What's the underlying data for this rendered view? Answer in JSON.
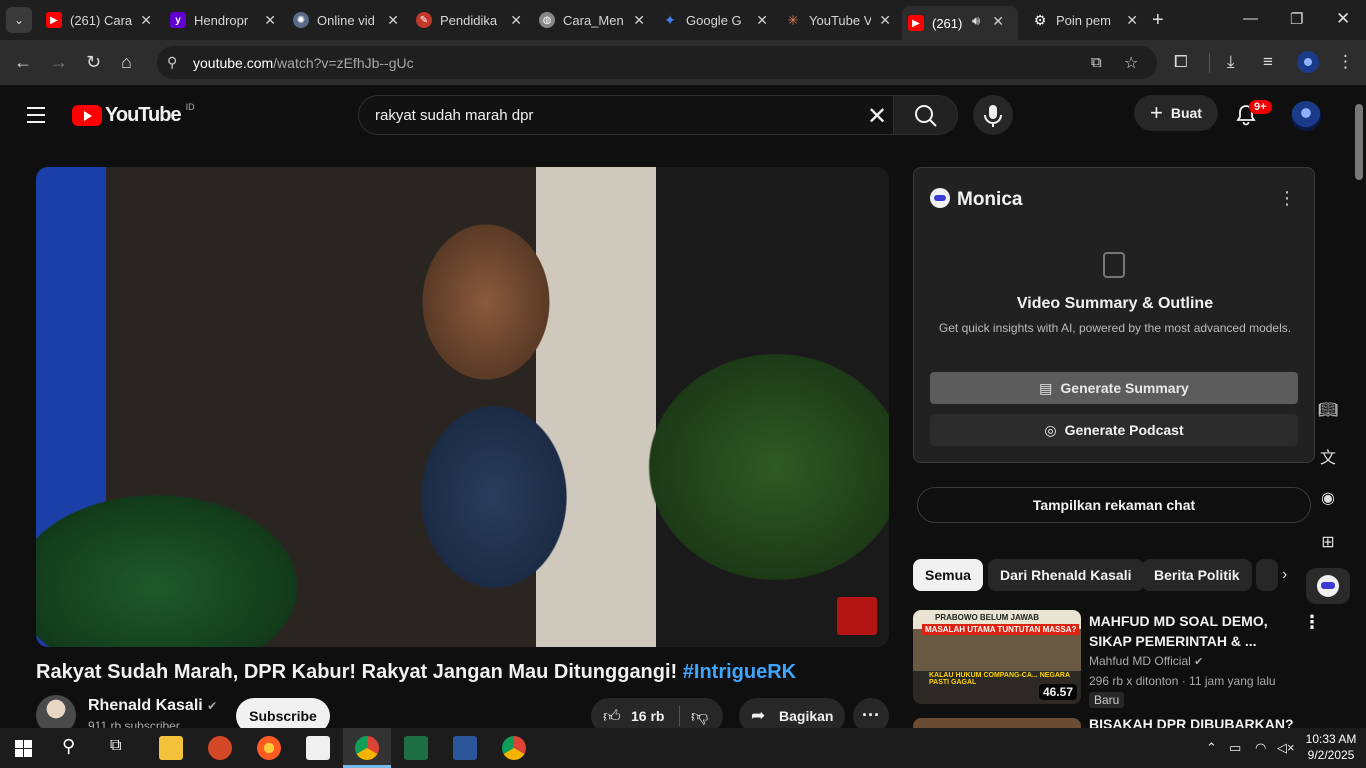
{
  "browser": {
    "tabs": [
      {
        "label": "(261) Cara",
        "favicon": "youtube",
        "color": "#ff0000"
      },
      {
        "label": "Hendropr",
        "favicon": "yahoo",
        "color": "#6001d2"
      },
      {
        "label": "Online vid",
        "favicon": "openai",
        "color": "#5a6a8a"
      },
      {
        "label": "Pendidika",
        "favicon": "pdf",
        "color": "#c0392b"
      },
      {
        "label": "Cara_Men",
        "favicon": "globe",
        "color": "#888888"
      },
      {
        "label": "Google G",
        "favicon": "gemini",
        "color": "#4285f4"
      },
      {
        "label": "YouTube V",
        "favicon": "claude",
        "color": "#d97757"
      },
      {
        "label": "(261)",
        "favicon": "youtube",
        "color": "#ff0000",
        "active": true
      },
      {
        "label": "Poin pem",
        "favicon": "openai",
        "color": "#ffffff"
      }
    ],
    "url_host": "youtube.com",
    "url_path": "/watch?v=zEfhJb--gUc"
  },
  "youtube": {
    "logo_text": "YouTube",
    "region": "ID",
    "search_query": "rakyat sudah marah dpr",
    "create_label": "Buat",
    "notif_count": "9+",
    "video": {
      "title": "Rakyat Sudah Marah, DPR Kabur! Rakyat Jangan Mau Ditunggangi!",
      "hashtag": "#IntrigueRK",
      "channel": "Rhenald Kasali",
      "subscribers": "911 rb subscriber",
      "subscribe_label": "Subscribe",
      "likes": "16 rb",
      "share_label": "Bagikan"
    },
    "monica": {
      "title": "Monica",
      "heading": "Video Summary & Outline",
      "subtitle": "Get quick insights with AI, powered by the most advanced models.",
      "summary_btn": "Generate Summary",
      "podcast_btn": "Generate Podcast",
      "chat_btn": "Tampilkan rekaman chat"
    },
    "chips": [
      "Semua",
      "Dari Rhenald Kasali",
      "Berita Politik"
    ],
    "related": [
      {
        "title_line1": "MAHFUD MD SOAL DEMO,",
        "title_line2": "SIKAP PEMERINTAH & ...",
        "channel": "Mahfud MD Official",
        "meta": "296 rb x ditonton · 11 jam yang lalu",
        "badge": "Baru",
        "duration": "46.57",
        "thumb_text1": "PRABOWO BELUM JAWAB",
        "thumb_text2": "MASALAH UTAMA TUNTUTAN MASSA?",
        "thumb_text3": "KALAU HUKUM COMPANG-CA... NEGARA PASTI GAGAL"
      },
      {
        "title_line1": "BISAKAH DPR DIBUBARKAN?"
      }
    ]
  },
  "taskbar": {
    "time": "10:33 AM",
    "date": "9/2/2025"
  }
}
